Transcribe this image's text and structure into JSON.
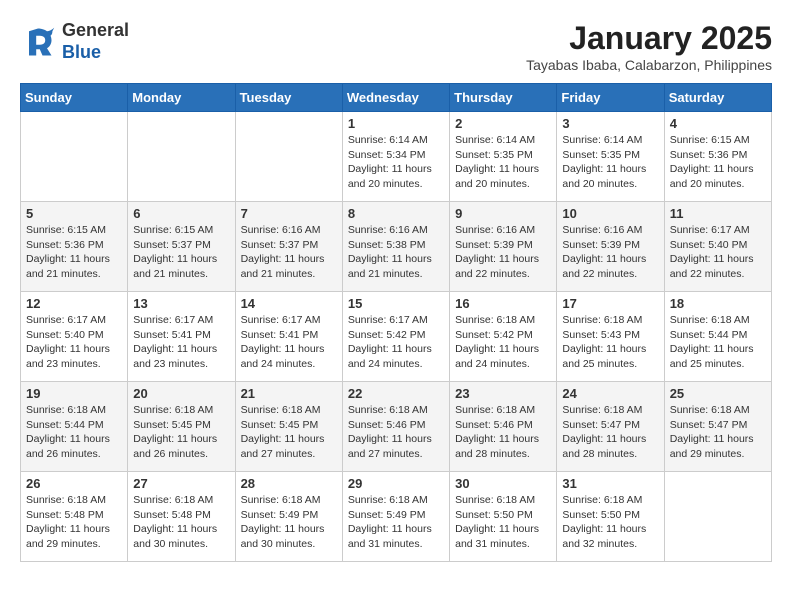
{
  "header": {
    "logo_general": "General",
    "logo_blue": "Blue",
    "month_title": "January 2025",
    "subtitle": "Tayabas Ibaba, Calabarzon, Philippines"
  },
  "weekdays": [
    "Sunday",
    "Monday",
    "Tuesday",
    "Wednesday",
    "Thursday",
    "Friday",
    "Saturday"
  ],
  "weeks": [
    [
      {
        "day": "",
        "info": ""
      },
      {
        "day": "",
        "info": ""
      },
      {
        "day": "",
        "info": ""
      },
      {
        "day": "1",
        "info": "Sunrise: 6:14 AM\nSunset: 5:34 PM\nDaylight: 11 hours\nand 20 minutes."
      },
      {
        "day": "2",
        "info": "Sunrise: 6:14 AM\nSunset: 5:35 PM\nDaylight: 11 hours\nand 20 minutes."
      },
      {
        "day": "3",
        "info": "Sunrise: 6:14 AM\nSunset: 5:35 PM\nDaylight: 11 hours\nand 20 minutes."
      },
      {
        "day": "4",
        "info": "Sunrise: 6:15 AM\nSunset: 5:36 PM\nDaylight: 11 hours\nand 20 minutes."
      }
    ],
    [
      {
        "day": "5",
        "info": "Sunrise: 6:15 AM\nSunset: 5:36 PM\nDaylight: 11 hours\nand 21 minutes."
      },
      {
        "day": "6",
        "info": "Sunrise: 6:15 AM\nSunset: 5:37 PM\nDaylight: 11 hours\nand 21 minutes."
      },
      {
        "day": "7",
        "info": "Sunrise: 6:16 AM\nSunset: 5:37 PM\nDaylight: 11 hours\nand 21 minutes."
      },
      {
        "day": "8",
        "info": "Sunrise: 6:16 AM\nSunset: 5:38 PM\nDaylight: 11 hours\nand 21 minutes."
      },
      {
        "day": "9",
        "info": "Sunrise: 6:16 AM\nSunset: 5:39 PM\nDaylight: 11 hours\nand 22 minutes."
      },
      {
        "day": "10",
        "info": "Sunrise: 6:16 AM\nSunset: 5:39 PM\nDaylight: 11 hours\nand 22 minutes."
      },
      {
        "day": "11",
        "info": "Sunrise: 6:17 AM\nSunset: 5:40 PM\nDaylight: 11 hours\nand 22 minutes."
      }
    ],
    [
      {
        "day": "12",
        "info": "Sunrise: 6:17 AM\nSunset: 5:40 PM\nDaylight: 11 hours\nand 23 minutes."
      },
      {
        "day": "13",
        "info": "Sunrise: 6:17 AM\nSunset: 5:41 PM\nDaylight: 11 hours\nand 23 minutes."
      },
      {
        "day": "14",
        "info": "Sunrise: 6:17 AM\nSunset: 5:41 PM\nDaylight: 11 hours\nand 24 minutes."
      },
      {
        "day": "15",
        "info": "Sunrise: 6:17 AM\nSunset: 5:42 PM\nDaylight: 11 hours\nand 24 minutes."
      },
      {
        "day": "16",
        "info": "Sunrise: 6:18 AM\nSunset: 5:42 PM\nDaylight: 11 hours\nand 24 minutes."
      },
      {
        "day": "17",
        "info": "Sunrise: 6:18 AM\nSunset: 5:43 PM\nDaylight: 11 hours\nand 25 minutes."
      },
      {
        "day": "18",
        "info": "Sunrise: 6:18 AM\nSunset: 5:44 PM\nDaylight: 11 hours\nand 25 minutes."
      }
    ],
    [
      {
        "day": "19",
        "info": "Sunrise: 6:18 AM\nSunset: 5:44 PM\nDaylight: 11 hours\nand 26 minutes."
      },
      {
        "day": "20",
        "info": "Sunrise: 6:18 AM\nSunset: 5:45 PM\nDaylight: 11 hours\nand 26 minutes."
      },
      {
        "day": "21",
        "info": "Sunrise: 6:18 AM\nSunset: 5:45 PM\nDaylight: 11 hours\nand 27 minutes."
      },
      {
        "day": "22",
        "info": "Sunrise: 6:18 AM\nSunset: 5:46 PM\nDaylight: 11 hours\nand 27 minutes."
      },
      {
        "day": "23",
        "info": "Sunrise: 6:18 AM\nSunset: 5:46 PM\nDaylight: 11 hours\nand 28 minutes."
      },
      {
        "day": "24",
        "info": "Sunrise: 6:18 AM\nSunset: 5:47 PM\nDaylight: 11 hours\nand 28 minutes."
      },
      {
        "day": "25",
        "info": "Sunrise: 6:18 AM\nSunset: 5:47 PM\nDaylight: 11 hours\nand 29 minutes."
      }
    ],
    [
      {
        "day": "26",
        "info": "Sunrise: 6:18 AM\nSunset: 5:48 PM\nDaylight: 11 hours\nand 29 minutes."
      },
      {
        "day": "27",
        "info": "Sunrise: 6:18 AM\nSunset: 5:48 PM\nDaylight: 11 hours\nand 30 minutes."
      },
      {
        "day": "28",
        "info": "Sunrise: 6:18 AM\nSunset: 5:49 PM\nDaylight: 11 hours\nand 30 minutes."
      },
      {
        "day": "29",
        "info": "Sunrise: 6:18 AM\nSunset: 5:49 PM\nDaylight: 11 hours\nand 31 minutes."
      },
      {
        "day": "30",
        "info": "Sunrise: 6:18 AM\nSunset: 5:50 PM\nDaylight: 11 hours\nand 31 minutes."
      },
      {
        "day": "31",
        "info": "Sunrise: 6:18 AM\nSunset: 5:50 PM\nDaylight: 11 hours\nand 32 minutes."
      },
      {
        "day": "",
        "info": ""
      }
    ]
  ]
}
